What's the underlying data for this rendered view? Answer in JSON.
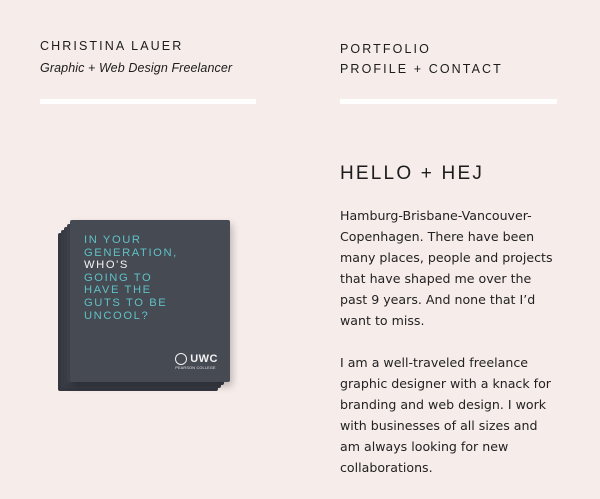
{
  "header": {
    "name": "CHRISTINA LAUER",
    "tagline": "Graphic + Web Design Freelancer"
  },
  "nav": {
    "items": [
      {
        "label": "PORTFOLIO"
      },
      {
        "label": "PROFILE + CONTACT"
      }
    ]
  },
  "main": {
    "heading": "HELLO + HEJ",
    "paragraphs": [
      "Hamburg-Brisbane-Vancouver-Copenhagen. There have been many places, people and projects that have shaped me over the past 9 years. And none that I’d want to miss.",
      "I am a well-traveled freelance graphic designer with a knack for branding and web design. I work with businesses of all sizes and am always looking for new collaborations."
    ]
  },
  "booklet": {
    "lines": [
      {
        "text": "IN YOUR",
        "color": "teal"
      },
      {
        "text": "GENERATION,",
        "color": "teal"
      },
      {
        "text": "WHO'S",
        "color": "white"
      },
      {
        "text": "GOING TO",
        "color": "teal"
      },
      {
        "text": "HAVE THE",
        "color": "teal"
      },
      {
        "text": "GUTS TO BE",
        "color": "teal"
      },
      {
        "text": "UNCOOL?",
        "color": "teal"
      }
    ],
    "logo_word": "UWC",
    "logo_sub": "PEARSON COLLEGE"
  },
  "colors": {
    "background": "#f6ecea",
    "rule": "#ffffff",
    "text": "#1c1c1c",
    "accent_teal": "#5fc1c6",
    "booklet_cover": "#464a53"
  }
}
